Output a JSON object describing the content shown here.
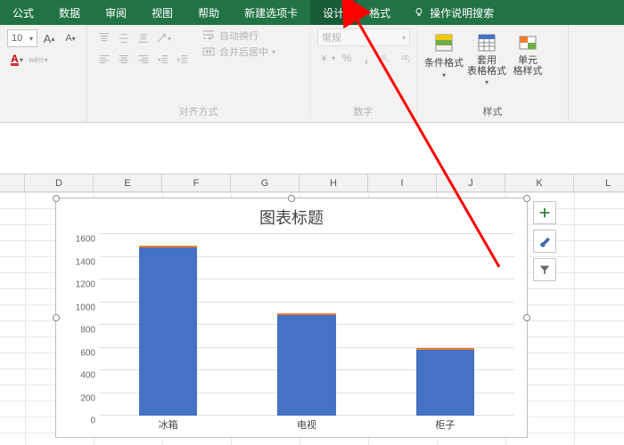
{
  "ribbon": {
    "tabs": [
      "公式",
      "数据",
      "审阅",
      "视图",
      "帮助",
      "新建选项卡",
      "设计",
      "格式"
    ],
    "highlight_index": 6,
    "tell_me": "操作说明搜索"
  },
  "font": {
    "size": "10",
    "wen_label": "wén"
  },
  "alignment": {
    "wrap_text": "自动换行",
    "merge_center": "合并后居中",
    "group_label": "对齐方式"
  },
  "number": {
    "format_name": "常规",
    "group_label": "数字"
  },
  "styles": {
    "cond_fmt": "条件格式",
    "as_table": "套用\n表格格式",
    "cell_styles": "单元\n格样式",
    "group_label": "样式"
  },
  "columns": [
    "",
    "D",
    "E",
    "F",
    "G",
    "H",
    "I",
    "J",
    "K",
    "L"
  ],
  "chart_data": {
    "type": "bar",
    "title": "图表标题",
    "categories": [
      "冰箱",
      "电视",
      "柜子"
    ],
    "values": [
      1500,
      900,
      600
    ],
    "ylim": [
      0,
      1600
    ],
    "y_ticks": [
      0,
      200,
      400,
      600,
      800,
      1000,
      1200,
      1400,
      1600
    ],
    "xlabel": "",
    "ylabel": ""
  },
  "side_buttons": [
    "plus",
    "brush",
    "funnel"
  ]
}
